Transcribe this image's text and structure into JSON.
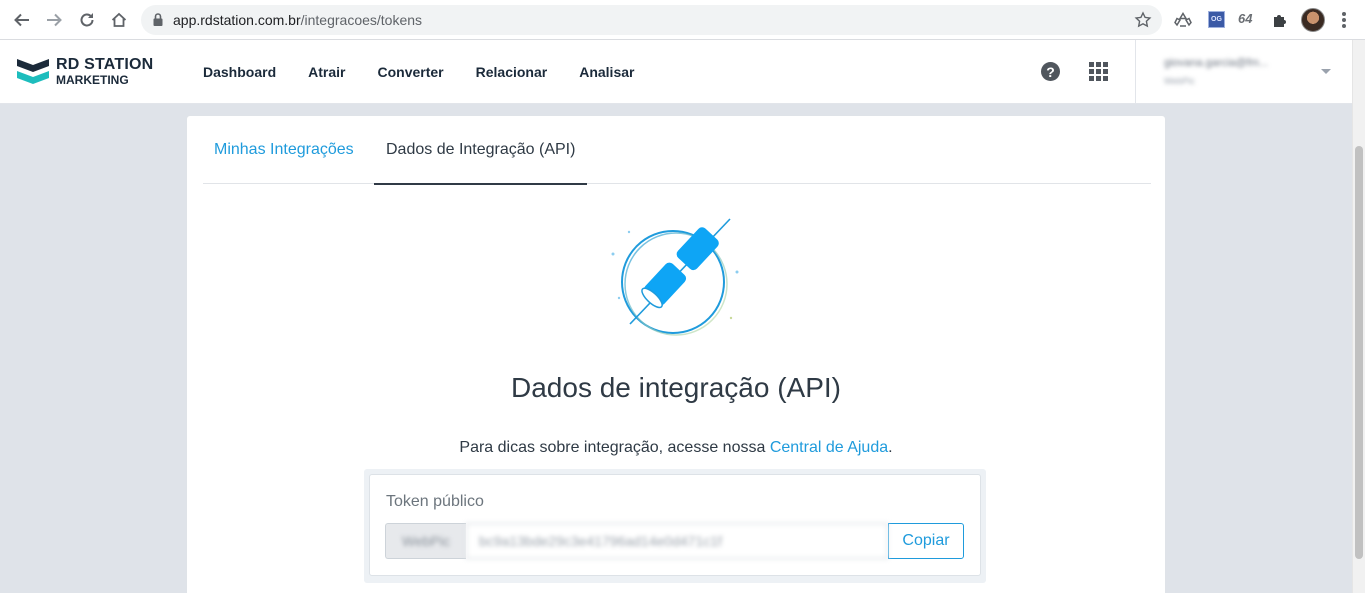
{
  "browser": {
    "url_host": "app.rdstation.com.br",
    "url_path": "/integracoes/tokens",
    "ext_og_label": "OG",
    "ext_64_label": "64"
  },
  "header": {
    "logo_line1": "RD STATION",
    "logo_line2": "MARKETING",
    "nav": [
      "Dashboard",
      "Atrair",
      "Converter",
      "Relacionar",
      "Analisar"
    ],
    "help_glyph": "?",
    "user_email": "giovana.garcia@fm...",
    "user_account": "WebPic"
  },
  "tabs": {
    "minhas": "Minhas Integrações",
    "dados": "Dados de Integração (API)"
  },
  "main": {
    "title": "Dados de integração (API)",
    "help_text": "Para dicas sobre integração, acesse nossa ",
    "help_link": "Central de Ajuda",
    "help_suffix": "."
  },
  "token": {
    "label": "Token público",
    "prefix": "WebPic",
    "value": "bc9a13bde29c3e41796ad14e0d471c1f",
    "copy_label": "Copiar"
  },
  "colors": {
    "accent": "#1f9bdc",
    "text": "#2f3a45",
    "background": "#dfe3e9"
  },
  "icons": {
    "back": "arrow-left-icon",
    "forward": "arrow-right-icon",
    "reload": "reload-icon",
    "home": "home-icon",
    "lock": "lock-icon",
    "star": "star-icon",
    "help": "question-circle-icon",
    "apps": "grid-icon"
  }
}
